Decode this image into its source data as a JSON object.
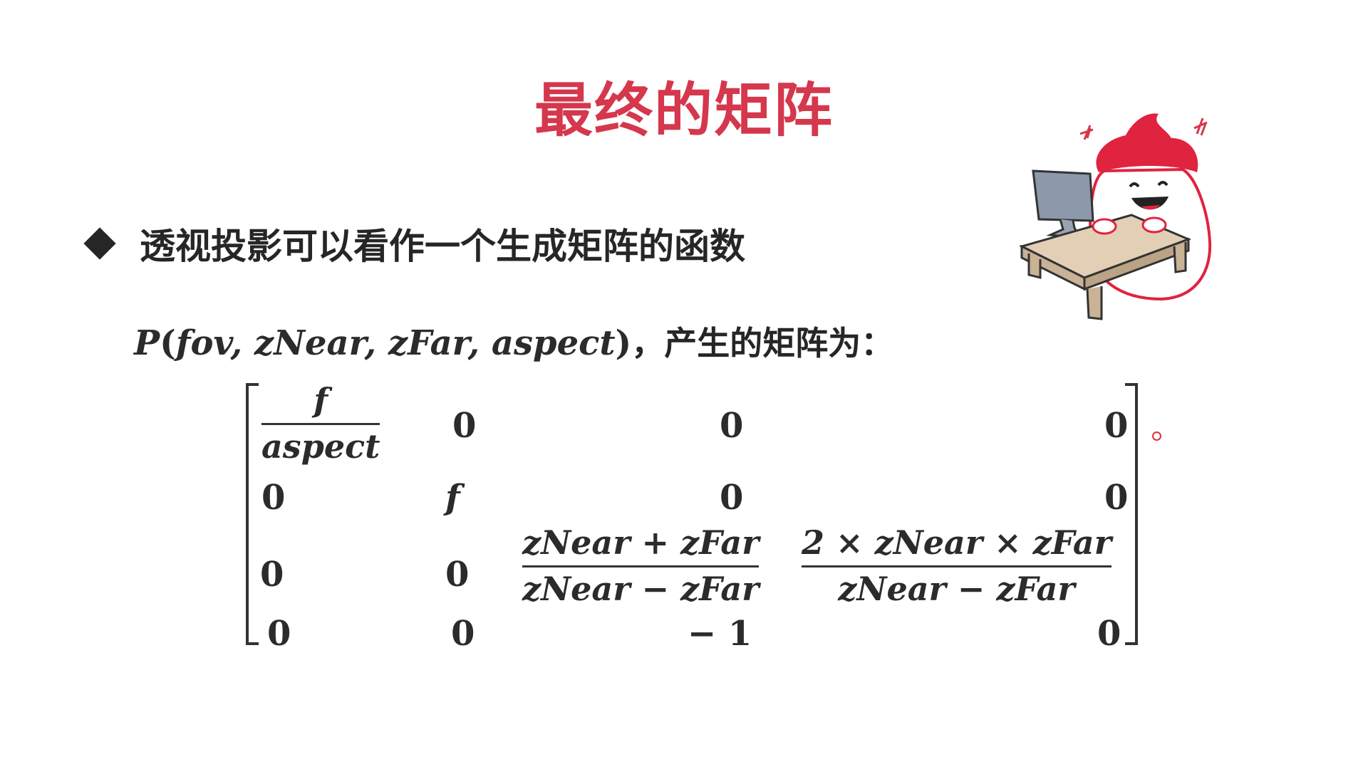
{
  "slide": {
    "title": "最终的矩阵",
    "bullet": "透视投影可以看作一个生成矩阵的函数",
    "function": {
      "name": "P",
      "args": "fov, zNear, zFar, aspect",
      "suffix": "，产生的矩阵为："
    }
  },
  "matrix": {
    "r1c1_num": "f",
    "r1c1_den": "aspect",
    "r1c2": "0",
    "r1c3": "0",
    "r1c4": "0",
    "r2c1": "0",
    "r2c2": "f",
    "r2c3": "0",
    "r2c4": "0",
    "r3c1": "0",
    "r3c2": "0",
    "r3c3_num": "zNear + zFar",
    "r3c3_den": "zNear − zFar",
    "r3c4_num": "2 × zNear × zFar",
    "r3c4_den": "zNear − zFar",
    "r4c1": "0",
    "r4c2": "0",
    "r4c3": "− 1",
    "r4c4": "0"
  },
  "colors": {
    "title": "#d5374d",
    "text": "#262626",
    "mascot_hair": "#e0233f",
    "pointer": "#e0303c"
  },
  "icons": {
    "bullet": "diamond-bullet-icon",
    "mascot": "mascot-at-computer-illustration",
    "pointer": "laser-pointer-icon"
  }
}
